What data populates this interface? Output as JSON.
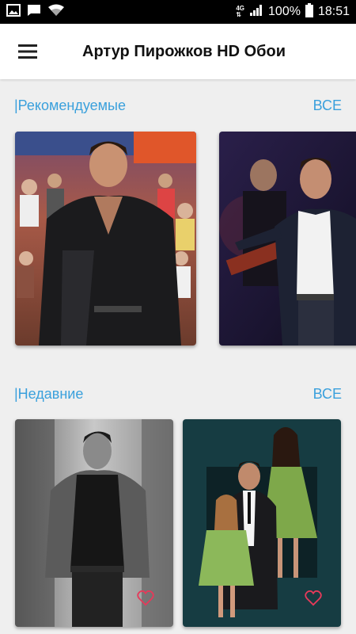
{
  "status_bar": {
    "network": "4G",
    "battery": "100%",
    "time": "18:51"
  },
  "app_bar": {
    "menu_icon": "hamburger-menu-icon",
    "title": "Артур Пирожков HD Обои"
  },
  "sections": [
    {
      "title": "|Рекомендуемые",
      "all_label": "ВСЕ"
    },
    {
      "title": "|Недавние",
      "all_label": "ВСЕ"
    }
  ],
  "colors": {
    "accent": "#3aa0dc",
    "background": "#efefef",
    "heart": "#e53a5a"
  }
}
